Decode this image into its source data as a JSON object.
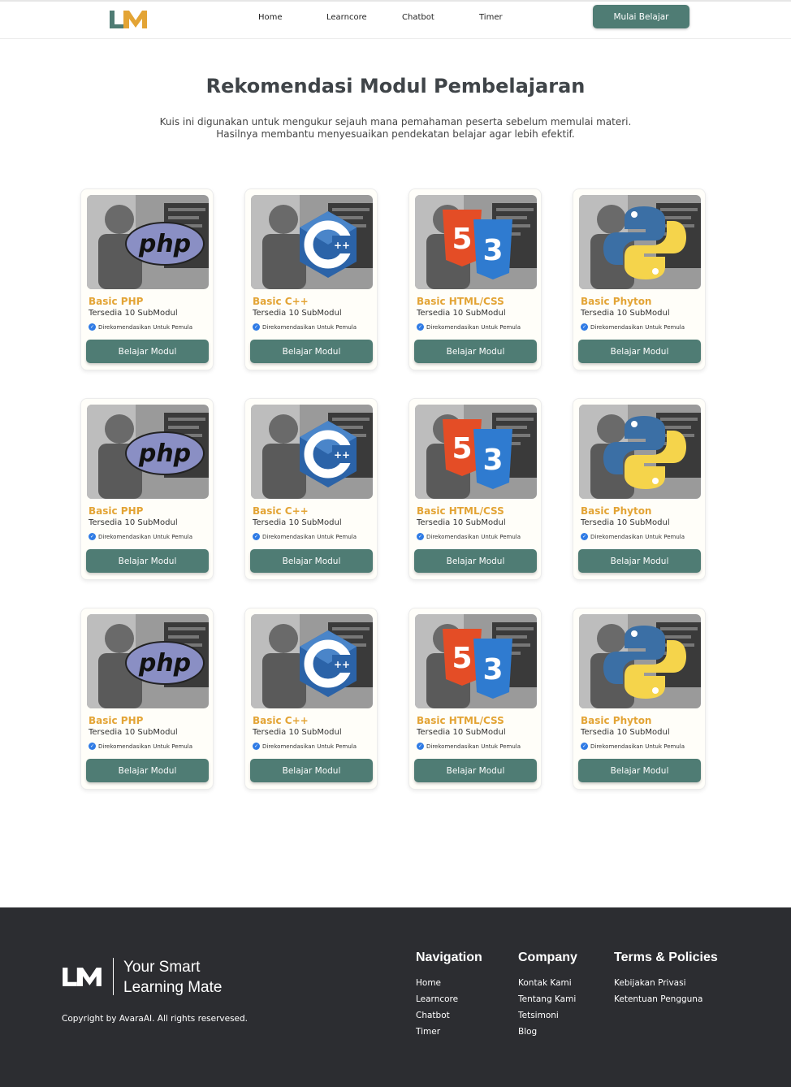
{
  "header": {
    "logo_text": "LM",
    "nav": [
      "Home",
      "Learncore",
      "Chatbot",
      "Timer"
    ],
    "cta_label": "Mulai Belajar"
  },
  "hero": {
    "title": "Rekomendasi Modul Pembelajaran",
    "subtitle_line1": "Kuis ini digunakan untuk mengukur sejauh mana pemahaman peserta sebelum memulai materi.",
    "subtitle_line2": "Hasilnya membantu menyesuaikan pendekatan belajar agar lebih efektif."
  },
  "modules": [
    {
      "title": "Basic PHP",
      "subtitle": "Tersedia 10 SubModul",
      "badge": "Direkomendasikan Untuk Pemula",
      "button": "Belajar Modul",
      "icon": "php-logo-icon"
    },
    {
      "title": "Basic C++",
      "subtitle": "Tersedia 10 SubModul",
      "badge": "Direkomendasikan Untuk Pemula",
      "button": "Belajar Modul",
      "icon": "cpp-logo-icon"
    },
    {
      "title": "Basic HTML/CSS",
      "subtitle": "Tersedia 10 SubModul",
      "badge": "Direkomendasikan Untuk Pemula",
      "button": "Belajar Modul",
      "icon": "html-css-logo-icon"
    },
    {
      "title": "Basic Phyton",
      "subtitle": "Tersedia 10 SubModul",
      "badge": "Direkomendasikan Untuk Pemula",
      "button": "Belajar Modul",
      "icon": "python-logo-icon"
    },
    {
      "title": "Basic PHP",
      "subtitle": "Tersedia 10 SubModul",
      "badge": "Direkomendasikan Untuk Pemula",
      "button": "Belajar Modul",
      "icon": "php-logo-icon"
    },
    {
      "title": "Basic C++",
      "subtitle": "Tersedia 10 SubModul",
      "badge": "Direkomendasikan Untuk Pemula",
      "button": "Belajar Modul",
      "icon": "cpp-logo-icon"
    },
    {
      "title": "Basic HTML/CSS",
      "subtitle": "Tersedia 10 SubModul",
      "badge": "Direkomendasikan Untuk Pemula",
      "button": "Belajar Modul",
      "icon": "html-css-logo-icon"
    },
    {
      "title": "Basic Phyton",
      "subtitle": "Tersedia 10 SubModul",
      "badge": "Direkomendasikan Untuk Pemula",
      "button": "Belajar Modul",
      "icon": "python-logo-icon"
    },
    {
      "title": "Basic PHP",
      "subtitle": "Tersedia 10 SubModul",
      "badge": "Direkomendasikan Untuk Pemula",
      "button": "Belajar Modul",
      "icon": "php-logo-icon"
    },
    {
      "title": "Basic C++",
      "subtitle": "Tersedia 10 SubModul",
      "badge": "Direkomendasikan Untuk Pemula",
      "button": "Belajar Modul",
      "icon": "cpp-logo-icon"
    },
    {
      "title": "Basic HTML/CSS",
      "subtitle": "Tersedia 10 SubModul",
      "badge": "Direkomendasikan Untuk Pemula",
      "button": "Belajar Modul",
      "icon": "html-css-logo-icon"
    },
    {
      "title": "Basic Phyton",
      "subtitle": "Tersedia 10 SubModul",
      "badge": "Direkomendasikan Untuk Pemula",
      "button": "Belajar Modul",
      "icon": "python-logo-icon"
    }
  ],
  "footer": {
    "logo_text": "LM",
    "tagline_line1": "Your Smart",
    "tagline_line2": "Learning Mate",
    "copyright": "Copyright by AvaraAI. All rights reservesed.",
    "navigation": {
      "heading": "Navigation",
      "links": [
        "Home",
        "Learncore",
        "Chatbot",
        "Timer"
      ]
    },
    "company": {
      "heading": "Company",
      "links": [
        "Kontak Kami",
        "Tentang Kami",
        "Tetsimoni",
        "Blog"
      ]
    },
    "terms": {
      "heading": "Terms & Policies",
      "links": [
        "Kebijakan Privasi",
        "Ketentuan Pengguna"
      ]
    }
  },
  "colors": {
    "primary": "#4f7c74",
    "accent": "#e3a435",
    "footer_bg": "#2c2d31",
    "badge_blue": "#2f7be5"
  }
}
